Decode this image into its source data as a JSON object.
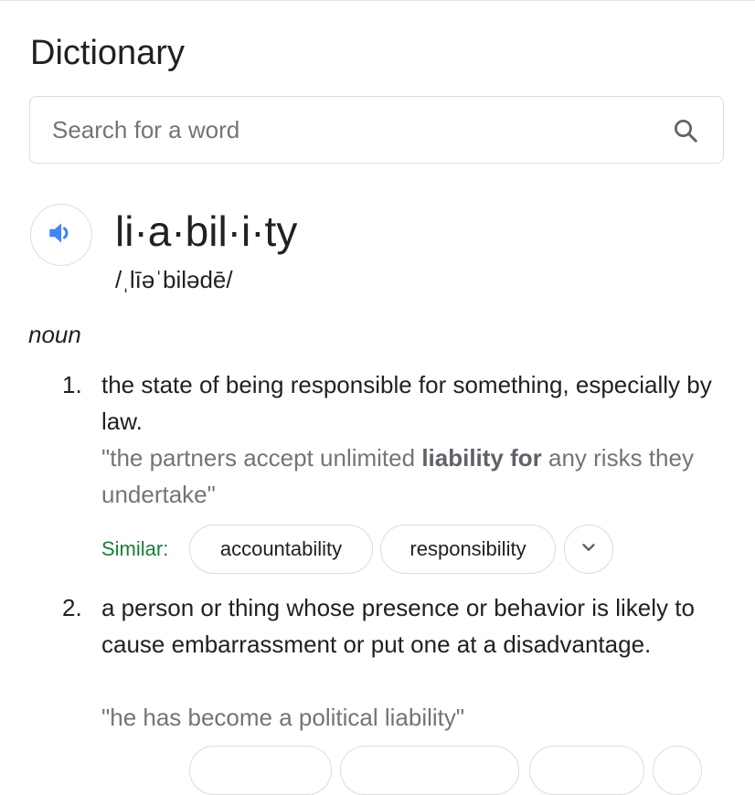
{
  "page": {
    "title": "Dictionary"
  },
  "search": {
    "placeholder": "Search for a word",
    "value": ""
  },
  "entry": {
    "headword": "li·a·bil·i·ty",
    "phonetic": "/ˌlīəˈbilədē/",
    "part_of_speech": "noun",
    "definitions": [
      {
        "number": "1.",
        "text": "the state of being responsible for something, especially by law.",
        "example_prefix": "\"the partners accept unlimited ",
        "example_bold": "liability for",
        "example_suffix": " any risks they undertake\"",
        "similar_label": "Similar:",
        "similar": [
          "accountability",
          "responsibility"
        ]
      },
      {
        "number": "2.",
        "text": "a person or thing whose presence or behavior is likely to cause embarrassment or put one at a disadvantage.",
        "example": "\"he has become a political liability\""
      }
    ]
  },
  "icons": {
    "search": "search-icon",
    "speaker": "speaker-icon",
    "expand": "chevron-down-icon"
  },
  "colors": {
    "accent_blue": "#4285f4",
    "similar_green": "#188038",
    "example_gray": "#70757a",
    "border": "#dadce0"
  }
}
